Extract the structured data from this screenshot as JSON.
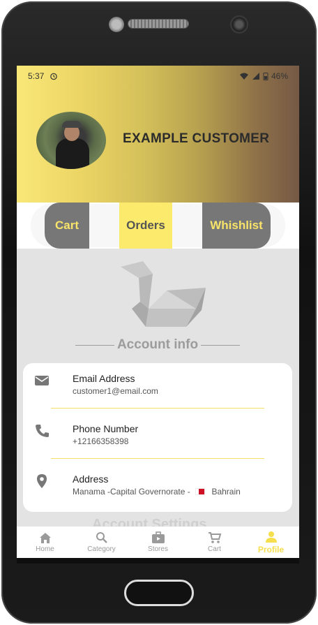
{
  "status_bar": {
    "time": "5:37",
    "battery": "46%"
  },
  "profile": {
    "name": "EXAMPLE CUSTOMER"
  },
  "tabs": [
    {
      "label": "Cart"
    },
    {
      "label": "Orders"
    },
    {
      "label": "Whishlist"
    }
  ],
  "section": {
    "title": "Account info",
    "next_title": "Account Settings"
  },
  "account_info": [
    {
      "icon": "mail-icon",
      "label": "Email Address",
      "value": "customer1@email.com"
    },
    {
      "icon": "phone-icon",
      "label": "Phone Number",
      "value": "+12166358398"
    },
    {
      "icon": "location-pin-icon",
      "label": "Address",
      "value": "Manama -Capital Governorate -",
      "country": "Bahrain"
    }
  ],
  "bottom_nav": [
    {
      "label": "Home",
      "icon": "home-icon"
    },
    {
      "label": "Category",
      "icon": "search-icon"
    },
    {
      "label": "Stores",
      "icon": "store-icon"
    },
    {
      "label": "Cart",
      "icon": "cart-icon"
    },
    {
      "label": "Profile",
      "icon": "person-icon",
      "active": true
    }
  ],
  "colors": {
    "accent": "#fbea6c",
    "tab_dark": "#777777",
    "nav_active": "#f5df4d"
  }
}
